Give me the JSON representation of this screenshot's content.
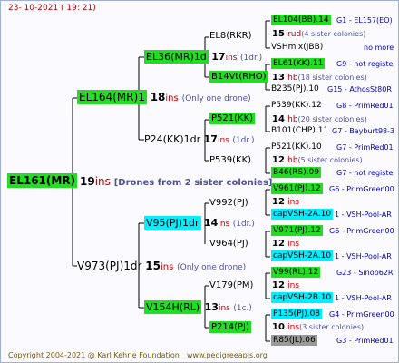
{
  "header": {
    "date": "23- 10-2021 ( 19: 21)"
  },
  "root": {
    "name": "EL161(MR)",
    "ins_num": "19",
    "ins": "ins",
    "note": "[Drones from 2 sister colonies]"
  },
  "g1": [
    {
      "name": "EL164(MR)1",
      "ins_num": "18",
      "ins": "ins",
      "note": "(Only one drone)"
    },
    {
      "name": "V973(PJ)1dr",
      "ins_num": "15",
      "ins": "ins",
      "note": "(Only one drone)"
    }
  ],
  "g2": [
    {
      "name": "EL36(MR)1d",
      "ins_num": "17",
      "ins": "ins",
      "note": "(1dr.)"
    },
    {
      "name": "P24(KK)1dr",
      "ins_num": "17",
      "ins": "ins",
      "note": "(1dr.)"
    },
    {
      "name": "V95(PJ)1dr",
      "ins_num": "14",
      "ins": "ins",
      "note": "(1dr.)"
    },
    {
      "name": "V154H(RL)",
      "ins_num": "13",
      "ins": "ins",
      "note": "(1c.)"
    }
  ],
  "g3": [
    {
      "name": "EL8(RKR)",
      "ins_num": "15",
      "ins": "rud",
      "note": "(4 sister colonies)"
    },
    {
      "name": "B14Vt(RHO)",
      "ins_num": "13",
      "ins": "hb",
      "note": "(18 sister colonies)"
    },
    {
      "name": "P521(KK)",
      "ins_num": "14",
      "ins": "hb",
      "note": "(20 sister colonies)"
    },
    {
      "name": "P539(KK)",
      "ins_num": "12",
      "ins": "hb",
      "note": "(5 sister colonies)"
    },
    {
      "name": "V992(PJ)",
      "ins_num": "12",
      "ins": "ins",
      "note": ""
    },
    {
      "name": "V964(PJ)",
      "ins_num": "12",
      "ins": "ins",
      "note": ""
    },
    {
      "name": "V179(PM)",
      "ins_num": "12",
      "ins": "ins",
      "note": ""
    },
    {
      "name": "P214(PJ)",
      "ins_num": "10",
      "ins": "ins",
      "note": "(3 sister colonies)"
    }
  ],
  "g4": [
    {
      "name": "EL104(BB).14",
      "info": "G1 - EL157(EO)"
    },
    {
      "name": "VSHmix(JBB)",
      "info": "no more"
    },
    {
      "name": "EL61(KK).11",
      "info": "G9 - not registe"
    },
    {
      "name": "B235(PJ).10",
      "info": "G15 - AthosSt80R"
    },
    {
      "name": "P539(KK).12",
      "info": "G8 - PrimRed01"
    },
    {
      "name": "B101(CHP).11",
      "info": "G7 - Bayburt98-3"
    },
    {
      "name": "P521(KK).10",
      "info": "G7 - PrimRed01"
    },
    {
      "name": "B46(RS).09",
      "info": "G7 - not registe"
    },
    {
      "name": "V961(PJ).12",
      "info": "G6 - PrimGreen00"
    },
    {
      "name": "capVSH-2A.10",
      "info": "1 - VSH-Pool-AR"
    },
    {
      "name": "V971(PJ).12",
      "info": "G6 - PrimGreen00"
    },
    {
      "name": "capVSH-2A.10",
      "info": "1 - VSH-Pool-AR"
    },
    {
      "name": "V99(RL).12",
      "info": "G23 - Sinop62R"
    },
    {
      "name": "capVSH-2B.10",
      "info": "1 - VSH-Pool-AR"
    },
    {
      "name": "P135(PJ).08",
      "info": "G4 - PrimGreen00"
    },
    {
      "name": "R85(JL).06",
      "info": "G3 - PrimRed01"
    }
  ],
  "footer": {
    "copyright": "Copyright 2004-2021 @ Karl Kehrle Foundation",
    "website": "www.pedigreeapis.org"
  }
}
